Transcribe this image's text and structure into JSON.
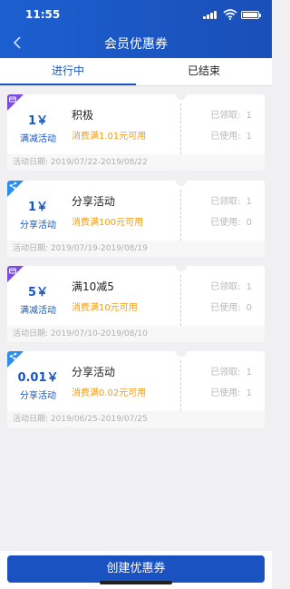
{
  "status_bar": {
    "time": "11:55"
  },
  "header": {
    "title": "会员优惠券"
  },
  "tabs": [
    {
      "label": "进行中",
      "active": true
    },
    {
      "label": "已结束",
      "active": false
    }
  ],
  "stats_labels": {
    "received": "已领取:",
    "used": "已使用:"
  },
  "coupons": [
    {
      "amount": "1￥",
      "kind": "满减活动",
      "badge": "card-icon",
      "badge_color": "#7a4de0",
      "name": "积极",
      "condition": "消费满1.01元可用",
      "received": "1",
      "used": "1",
      "date": "活动日期: 2019/07/22-2019/08/22"
    },
    {
      "amount": "1￥",
      "kind": "分享活动",
      "badge": "share-icon",
      "badge_color": "#2d8cf0",
      "name": "分享活动",
      "condition": "消费满100元可用",
      "received": "1",
      "used": "0",
      "date": "活动日期: 2019/07/19-2019/08/19"
    },
    {
      "amount": "5￥",
      "kind": "满减活动",
      "badge": "card-icon",
      "badge_color": "#7a4de0",
      "name": "满10减5",
      "condition": "消费满10元可用",
      "received": "1",
      "used": "0",
      "date": "活动日期: 2019/07/10-2019/08/10"
    },
    {
      "amount": "0.01￥",
      "kind": "分享活动",
      "badge": "share-icon",
      "badge_color": "#2d8cf0",
      "name": "分享活动",
      "condition": "消费满0.02元可用",
      "received": "1",
      "used": "1",
      "date": "活动日期: 2019/06/25-2019/07/25"
    }
  ],
  "footer": {
    "create_label": "创建优惠券"
  },
  "colors": {
    "primary": "#1a56c4",
    "orange": "#f39c12",
    "purple_badge": "#7a4de0",
    "blue_badge": "#2d8cf0"
  }
}
